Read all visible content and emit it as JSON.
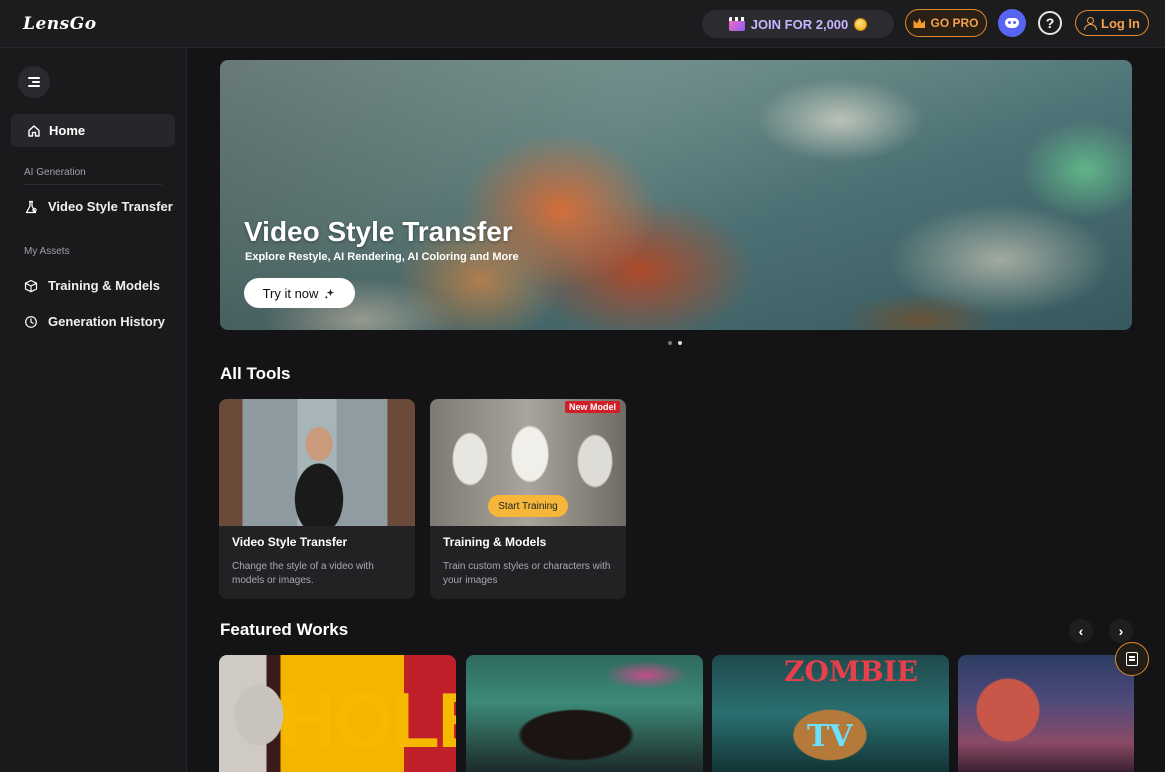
{
  "brand": {
    "logo": "LensGo"
  },
  "topbar": {
    "join_label": "JOIN FOR 2,000",
    "gopro_label": "GO PRO",
    "help_symbol": "?",
    "login_label": "Log In"
  },
  "sidebar": {
    "home_label": "Home",
    "section_ai": "AI Generation",
    "video_style_transfer_label": "Video Style Transfer",
    "section_assets": "My Assets",
    "training_models_label": "Training & Models",
    "generation_history_label": "Generation History"
  },
  "hero": {
    "title": "Video Style Transfer",
    "subtitle": "Explore Restyle, AI Rendering, AI Coloring and More",
    "cta_label": "Try it now"
  },
  "all_tools": {
    "heading": "All Tools",
    "cards": [
      {
        "title": "Video Style Transfer",
        "description": "Change the style of a video with models or images."
      },
      {
        "title": "Training & Models",
        "description": "Train custom styles or characters with your images",
        "badge": "New Model",
        "button": "Start Training"
      }
    ]
  },
  "featured": {
    "heading": "Featured Works",
    "prev_symbol": "‹",
    "next_symbol": "›",
    "works": [
      {
        "text": "HOLE"
      },
      {
        "text": ""
      },
      {
        "text": "ZOMBIE",
        "text2": "TV"
      },
      {
        "text": ""
      }
    ]
  },
  "colors": {
    "accent": "#e08a2a",
    "discord": "#5865f2",
    "badge_red": "#d11f2a",
    "start_training": "#f5b63a"
  },
  "icons": [
    "menu-icon",
    "home-icon",
    "flask-icon",
    "cube-icon",
    "clock-icon",
    "sparkle-icon",
    "crown-icon",
    "discord-icon",
    "user-icon",
    "feedback-icon",
    "coin-icon",
    "clapper-icon"
  ]
}
